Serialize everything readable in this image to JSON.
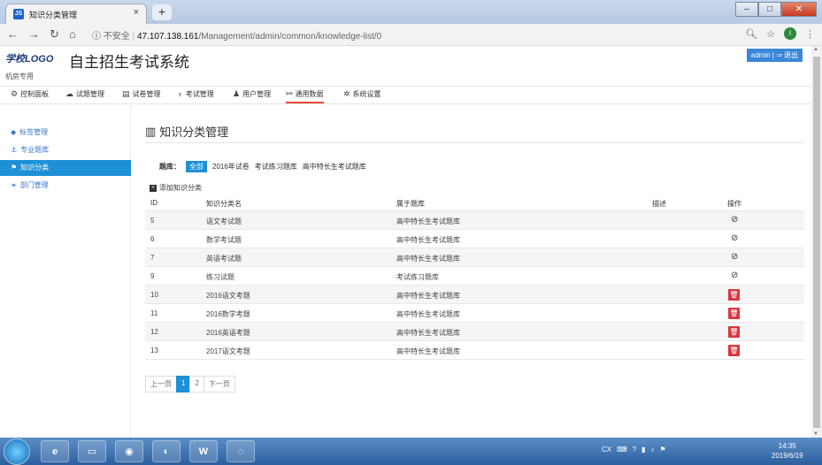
{
  "browser": {
    "tab_title": "知识分类管理",
    "tab_favicon": "JS",
    "url_security": "不安全",
    "url_host": "47.107.138.161",
    "url_path": "/Management/admin/common/knowledge-list/0",
    "profile_initial": "I"
  },
  "header": {
    "logo": "学校LOGO",
    "title": "自主招生考试系统",
    "subtitle": "机房专用",
    "user": "admin | ⇒ 退出"
  },
  "nav": {
    "items": [
      {
        "icon": "dashboard-icon",
        "label": "控制面板"
      },
      {
        "icon": "cloud-icon",
        "label": "试题管理"
      },
      {
        "icon": "file-icon",
        "label": "试卷管理"
      },
      {
        "icon": "trophy-icon",
        "label": "考试管理"
      },
      {
        "icon": "user-icon",
        "label": "用户管理"
      },
      {
        "icon": "share-icon",
        "label": "通用数据"
      },
      {
        "icon": "gear-icon",
        "label": "系统设置"
      }
    ],
    "active": "通用数据"
  },
  "sidebar": {
    "items": [
      {
        "label": "标签管理"
      },
      {
        "label": "专业题库"
      },
      {
        "label": "知识分类"
      },
      {
        "label": "部门管理"
      }
    ],
    "active": "知识分类"
  },
  "main": {
    "page_title": "知识分类管理",
    "filter_label": "题库：",
    "filters": [
      "全部",
      "2016年试卷",
      "考试练习题库",
      "高中特长生考试题库"
    ],
    "add_label": "添加知识分类",
    "table": {
      "headers": [
        "ID",
        "知识分类名",
        "属于题库",
        "描述",
        "操作"
      ],
      "rows": [
        {
          "id": "5",
          "name": "语文考试题",
          "lib": "高中特长生考试题库",
          "desc": "",
          "op": "ban"
        },
        {
          "id": "6",
          "name": "数学考试题",
          "lib": "高中特长生考试题库",
          "desc": "",
          "op": "ban"
        },
        {
          "id": "7",
          "name": "英语考试题",
          "lib": "高中特长生考试题库",
          "desc": "",
          "op": "ban"
        },
        {
          "id": "9",
          "name": "练习试题",
          "lib": "考试练习题库",
          "desc": "",
          "op": "ban"
        },
        {
          "id": "10",
          "name": "2016语文考题",
          "lib": "高中特长生考试题库",
          "desc": "",
          "op": "delete"
        },
        {
          "id": "11",
          "name": "2016数学考题",
          "lib": "高中特长生考试题库",
          "desc": "",
          "op": "delete"
        },
        {
          "id": "12",
          "name": "2016英语考题",
          "lib": "高中特长生考试题库",
          "desc": "",
          "op": "delete"
        },
        {
          "id": "13",
          "name": "2017语文考题",
          "lib": "高中特长生考试题库",
          "desc": "",
          "op": "delete"
        }
      ]
    },
    "pager": {
      "prev": "上一页",
      "pages": [
        "1",
        "2"
      ],
      "current": "1",
      "next": "下一页"
    }
  },
  "taskbar": {
    "tray_text": "CX",
    "time": "14:35",
    "date": "2019/6/19"
  }
}
